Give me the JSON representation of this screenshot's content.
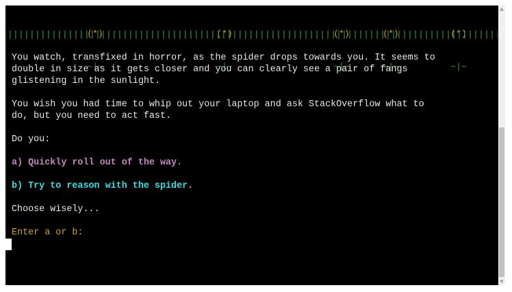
{
  "scene": {
    "flower_head": "(*)",
    "flower_stem": "~|~",
    "grass": "||||||||||||||||||||||||||||||||||||||||||||||||||||||||||||||||||||||||||||||||||||||||||||||||"
  },
  "story": {
    "paragraph_1": "You watch, transfixed in horror, as the spider drops towards you. It seems to\ndouble in size as it gets closer and you can clearly see a pair of fangs\nglistening in the sunlight.",
    "paragraph_2": "You wish you had time to whip out your laptop and ask StackOverflow what to\ndo, but you need to act fast.",
    "question": "Do you:",
    "option_a": "a) Quickly roll out of the way.",
    "option_b": "b) Try to reason with the spider.",
    "advice": "Choose wisely...",
    "prompt": "Enter a or b:"
  },
  "colors": {
    "background": "#000000",
    "text": "#e8e8e8",
    "flower_head": "#d7a030",
    "stem_and_grass": "#3f9e3f",
    "option_a": "#c586c0",
    "option_b": "#33dfe8",
    "prompt": "#d7a030"
  },
  "icons": {
    "scroll_up": "▲",
    "scroll_down": "▼"
  }
}
